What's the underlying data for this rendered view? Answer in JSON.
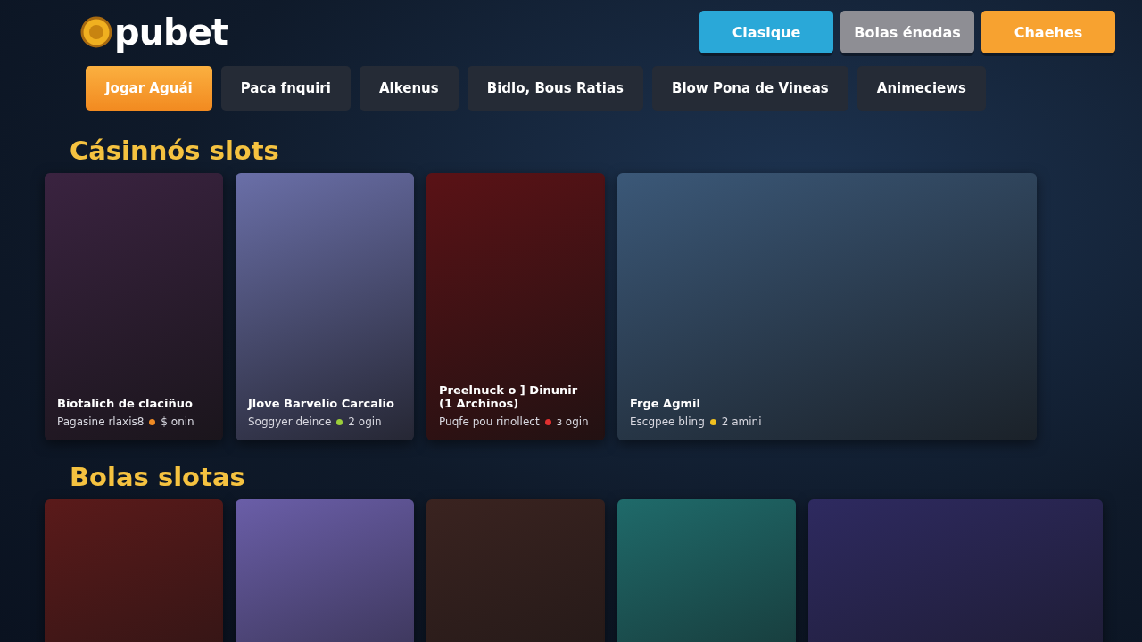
{
  "logo": {
    "text": "pubet"
  },
  "top_buttons": [
    {
      "label": "Clasique",
      "color": "#2aa8d8"
    },
    {
      "label": "Bolas énodas",
      "color": "#8e8e94"
    },
    {
      "label": "Chaehes",
      "color": "#f7a230"
    }
  ],
  "nav_tabs": [
    {
      "label": "Jogar Aguái",
      "selected": true
    },
    {
      "label": "Paca fnquiri",
      "selected": false
    },
    {
      "label": "Alkenus",
      "selected": false
    },
    {
      "label": "Bidlo, Bous Ratias",
      "selected": false
    },
    {
      "label": "Blow Pona de Vineas",
      "selected": false
    },
    {
      "label": "Animeciews",
      "selected": false
    }
  ],
  "sections": [
    {
      "title": "Cásinnós slots",
      "cards": [
        {
          "kind": "tall",
          "name": "Biotalich de claciñuo",
          "meta": "Pagasine rlaxis8",
          "count": "$ onin",
          "color": "#f08a24"
        },
        {
          "kind": "tall",
          "name": "Jlove Barvelio Carcalio",
          "meta": "Soggyer deince",
          "count": "2 ogin",
          "color": "#9ccf3a"
        },
        {
          "kind": "tall",
          "name": "Preelnuck o ] Dinunir (1 Archinos)",
          "meta": "Puqfe pou rinollect",
          "count": "з ogin",
          "color": "#e03030"
        },
        {
          "kind": "wide",
          "name": "Frge Agmil",
          "meta": "Escgpee bling",
          "count": "2 amini",
          "color": "#f0c020"
        }
      ]
    },
    {
      "title": "Bolas slotas",
      "cards": [
        {
          "kind": "tall"
        },
        {
          "kind": "tall"
        },
        {
          "kind": "tall"
        },
        {
          "kind": "tall"
        },
        {
          "kind": "wide"
        }
      ]
    }
  ]
}
